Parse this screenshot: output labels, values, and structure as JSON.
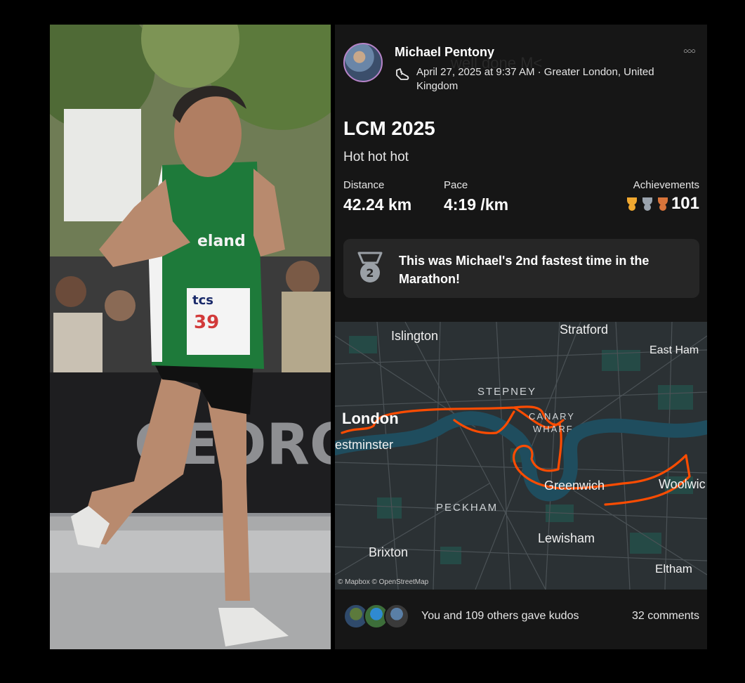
{
  "post": {
    "athlete_name": "Michael Pentony",
    "overlay_text": "well done M<",
    "date_location": "April 27, 2025 at 9:37 AM · Greater London, United Kingdom",
    "title": "LCM 2025",
    "description": "Hot hot hot"
  },
  "stats": {
    "distance_label": "Distance",
    "distance_value": "42.24 km",
    "pace_label": "Pace",
    "pace_value": "4:19 /km",
    "achievements_label": "Achievements",
    "achievements_value": "101"
  },
  "banner": {
    "medal_number": "2",
    "text": "This was Michael's 2nd fastest time in the Marathon!"
  },
  "map": {
    "labels": {
      "islington": "Islington",
      "stratford": "Stratford",
      "east_ham": "East Ham",
      "stepney": "STEPNEY",
      "london": "London",
      "canary": "CANARY",
      "wharf": "WHARF",
      "westminster": "estminster",
      "greenwich": "Greenwich",
      "woolwich": "Woolwic",
      "peckham": "PECKHAM",
      "lewisham": "Lewisham",
      "brixton": "Brixton",
      "eltham": "Eltham"
    },
    "attribution": "© Mapbox © OpenStreetMap",
    "route_color": "#fc4c02"
  },
  "footer": {
    "kudos_text": "You and 109 others gave kudos",
    "comments_text": "32 comments"
  },
  "photo": {
    "bib_brand": "tcs",
    "bib_number": "39",
    "vest_text": "eland",
    "barrier_text": "GEORO"
  }
}
